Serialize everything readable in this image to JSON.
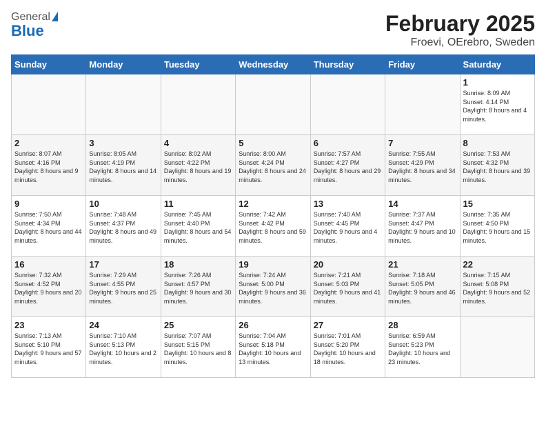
{
  "header": {
    "logo_general": "General",
    "logo_blue": "Blue",
    "title": "February 2025",
    "subtitle": "Froevi, OErebro, Sweden"
  },
  "days_of_week": [
    "Sunday",
    "Monday",
    "Tuesday",
    "Wednesday",
    "Thursday",
    "Friday",
    "Saturday"
  ],
  "weeks": [
    [
      {
        "day": "",
        "info": ""
      },
      {
        "day": "",
        "info": ""
      },
      {
        "day": "",
        "info": ""
      },
      {
        "day": "",
        "info": ""
      },
      {
        "day": "",
        "info": ""
      },
      {
        "day": "",
        "info": ""
      },
      {
        "day": "1",
        "info": "Sunrise: 8:09 AM\nSunset: 4:14 PM\nDaylight: 8 hours and 4 minutes."
      }
    ],
    [
      {
        "day": "2",
        "info": "Sunrise: 8:07 AM\nSunset: 4:16 PM\nDaylight: 8 hours and 9 minutes."
      },
      {
        "day": "3",
        "info": "Sunrise: 8:05 AM\nSunset: 4:19 PM\nDaylight: 8 hours and 14 minutes."
      },
      {
        "day": "4",
        "info": "Sunrise: 8:02 AM\nSunset: 4:22 PM\nDaylight: 8 hours and 19 minutes."
      },
      {
        "day": "5",
        "info": "Sunrise: 8:00 AM\nSunset: 4:24 PM\nDaylight: 8 hours and 24 minutes."
      },
      {
        "day": "6",
        "info": "Sunrise: 7:57 AM\nSunset: 4:27 PM\nDaylight: 8 hours and 29 minutes."
      },
      {
        "day": "7",
        "info": "Sunrise: 7:55 AM\nSunset: 4:29 PM\nDaylight: 8 hours and 34 minutes."
      },
      {
        "day": "8",
        "info": "Sunrise: 7:53 AM\nSunset: 4:32 PM\nDaylight: 8 hours and 39 minutes."
      }
    ],
    [
      {
        "day": "9",
        "info": "Sunrise: 7:50 AM\nSunset: 4:34 PM\nDaylight: 8 hours and 44 minutes."
      },
      {
        "day": "10",
        "info": "Sunrise: 7:48 AM\nSunset: 4:37 PM\nDaylight: 8 hours and 49 minutes."
      },
      {
        "day": "11",
        "info": "Sunrise: 7:45 AM\nSunset: 4:40 PM\nDaylight: 8 hours and 54 minutes."
      },
      {
        "day": "12",
        "info": "Sunrise: 7:42 AM\nSunset: 4:42 PM\nDaylight: 8 hours and 59 minutes."
      },
      {
        "day": "13",
        "info": "Sunrise: 7:40 AM\nSunset: 4:45 PM\nDaylight: 9 hours and 4 minutes."
      },
      {
        "day": "14",
        "info": "Sunrise: 7:37 AM\nSunset: 4:47 PM\nDaylight: 9 hours and 10 minutes."
      },
      {
        "day": "15",
        "info": "Sunrise: 7:35 AM\nSunset: 4:50 PM\nDaylight: 9 hours and 15 minutes."
      }
    ],
    [
      {
        "day": "16",
        "info": "Sunrise: 7:32 AM\nSunset: 4:52 PM\nDaylight: 9 hours and 20 minutes."
      },
      {
        "day": "17",
        "info": "Sunrise: 7:29 AM\nSunset: 4:55 PM\nDaylight: 9 hours and 25 minutes."
      },
      {
        "day": "18",
        "info": "Sunrise: 7:26 AM\nSunset: 4:57 PM\nDaylight: 9 hours and 30 minutes."
      },
      {
        "day": "19",
        "info": "Sunrise: 7:24 AM\nSunset: 5:00 PM\nDaylight: 9 hours and 36 minutes."
      },
      {
        "day": "20",
        "info": "Sunrise: 7:21 AM\nSunset: 5:03 PM\nDaylight: 9 hours and 41 minutes."
      },
      {
        "day": "21",
        "info": "Sunrise: 7:18 AM\nSunset: 5:05 PM\nDaylight: 9 hours and 46 minutes."
      },
      {
        "day": "22",
        "info": "Sunrise: 7:15 AM\nSunset: 5:08 PM\nDaylight: 9 hours and 52 minutes."
      }
    ],
    [
      {
        "day": "23",
        "info": "Sunrise: 7:13 AM\nSunset: 5:10 PM\nDaylight: 9 hours and 57 minutes."
      },
      {
        "day": "24",
        "info": "Sunrise: 7:10 AM\nSunset: 5:13 PM\nDaylight: 10 hours and 2 minutes."
      },
      {
        "day": "25",
        "info": "Sunrise: 7:07 AM\nSunset: 5:15 PM\nDaylight: 10 hours and 8 minutes."
      },
      {
        "day": "26",
        "info": "Sunrise: 7:04 AM\nSunset: 5:18 PM\nDaylight: 10 hours and 13 minutes."
      },
      {
        "day": "27",
        "info": "Sunrise: 7:01 AM\nSunset: 5:20 PM\nDaylight: 10 hours and 18 minutes."
      },
      {
        "day": "28",
        "info": "Sunrise: 6:59 AM\nSunset: 5:23 PM\nDaylight: 10 hours and 23 minutes."
      },
      {
        "day": "",
        "info": ""
      }
    ]
  ]
}
